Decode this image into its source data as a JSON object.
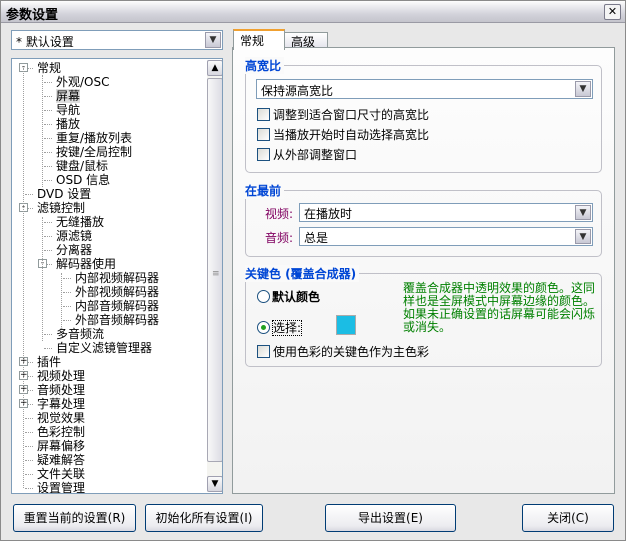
{
  "window": {
    "title": "参数设置",
    "close": "✕"
  },
  "preset": {
    "value": "* 默认设置"
  },
  "tree": [
    {
      "label": "常规",
      "level": 0,
      "exp": "-"
    },
    {
      "label": "外观/OSC",
      "level": 1
    },
    {
      "label": "屏幕",
      "level": 1,
      "selected": true
    },
    {
      "label": "导航",
      "level": 1
    },
    {
      "label": "播放",
      "level": 1
    },
    {
      "label": "重复/播放列表",
      "level": 1
    },
    {
      "label": "按键/全局控制",
      "level": 1
    },
    {
      "label": "键盘/鼠标",
      "level": 1
    },
    {
      "label": "OSD 信息",
      "level": 1
    },
    {
      "label": "DVD 设置",
      "level": 0
    },
    {
      "label": "滤镜控制",
      "level": 0,
      "exp": "-"
    },
    {
      "label": "无缝播放",
      "level": 1
    },
    {
      "label": "源滤镜",
      "level": 1
    },
    {
      "label": "分离器",
      "level": 1
    },
    {
      "label": "解码器使用",
      "level": 1,
      "exp": "-"
    },
    {
      "label": "内部视频解码器",
      "level": 2
    },
    {
      "label": "外部视频解码器",
      "level": 2
    },
    {
      "label": "内部音频解码器",
      "level": 2
    },
    {
      "label": "外部音频解码器",
      "level": 2
    },
    {
      "label": "多音频流",
      "level": 1
    },
    {
      "label": "自定义滤镜管理器",
      "level": 1
    },
    {
      "label": "插件",
      "level": 0,
      "exp": "+"
    },
    {
      "label": "视频处理",
      "level": 0,
      "exp": "+"
    },
    {
      "label": "音频处理",
      "level": 0,
      "exp": "+"
    },
    {
      "label": "字幕处理",
      "level": 0,
      "exp": "+"
    },
    {
      "label": "视觉效果",
      "level": 0
    },
    {
      "label": "色彩控制",
      "level": 0
    },
    {
      "label": "屏幕偏移",
      "level": 0
    },
    {
      "label": "疑难解答",
      "level": 0
    },
    {
      "label": "文件关联",
      "level": 0
    },
    {
      "label": "设置管理",
      "level": 0
    }
  ],
  "tabs": [
    {
      "label": "常规"
    },
    {
      "label": "高级"
    }
  ],
  "aspect": {
    "title": "高宽比",
    "combo": "保持源高宽比",
    "checks": [
      "调整到适合窗口尺寸的高宽比",
      "当播放开始时自动选择高宽比",
      "从外部调整窗口"
    ]
  },
  "ontop": {
    "title": "在最前",
    "video_label": "视频:",
    "video_value": "在播放时",
    "audio_label": "音频:",
    "audio_value": "总是"
  },
  "colorkey": {
    "title": "关键色 (覆盖合成器)",
    "default_label": "默认颜色",
    "choose_label": "选择:",
    "swatch_color": "#1bbde4",
    "note": "覆盖合成器中透明效果的颜色。这同样也是全屏模式中屏幕边缘的颜色。如果未正确设置的话屏幕可能会闪烁或消失。",
    "use_check": "使用色彩的关键色作为主色彩"
  },
  "buttons": {
    "reset": "重置当前的设置(R)",
    "init": "初始化所有设置(I)",
    "export": "导出设置(E)",
    "close": "关闭(C)"
  }
}
